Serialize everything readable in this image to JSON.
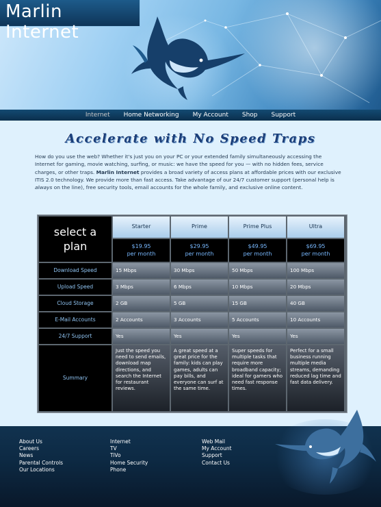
{
  "brand": {
    "name": "Marlin Internet"
  },
  "nav": {
    "items": [
      "Internet",
      "Home Networking",
      "My Account",
      "Shop",
      "Support"
    ],
    "active": "Internet"
  },
  "main": {
    "headline": "Accelerate with No Speed Traps",
    "intro": {
      "p1": "How do you use the web? Whether it's just you on your PC or your extended family simultaneously accessing the Internet for gaming, movie watching, surfing, or music: we have the speed for you — with no hidden fees, service charges, or other traps. ",
      "brand": "Marlin Internet",
      "p2": " provides a broad variety of access plans at affordable prices with our exclusive ITIS 2.0 technology. We provide more than fast access. Take advantage of our 24/7 customer support (personal help is ",
      "emph": "always",
      "p3": " on the line), free security tools, email accounts for the whole family, and exclusive online content."
    }
  },
  "plans": {
    "corner_line1": "select a",
    "corner_line2": "plan",
    "columns": [
      {
        "name": "Starter",
        "price": "$19.95",
        "period": "per month"
      },
      {
        "name": "Prime",
        "price": "$29.95",
        "period": "per month"
      },
      {
        "name": "Prime Plus",
        "price": "$49.95",
        "period": "per month"
      },
      {
        "name": "Ultra",
        "price": "$69.95",
        "period": "per month"
      }
    ],
    "rows": [
      {
        "label": "Download Speed",
        "values": [
          "15 Mbps",
          "30 Mbps",
          "50 Mbps",
          "100 Mbps"
        ]
      },
      {
        "label": "Upload Speed",
        "values": [
          "3 Mbps",
          "6 Mbps",
          "10 Mbps",
          "20 Mbps"
        ]
      },
      {
        "label": "Cloud Storage",
        "values": [
          "2 GB",
          "5 GB",
          "15 GB",
          "40 GB"
        ]
      },
      {
        "label": "E-Mail Accounts",
        "values": [
          "2 Accounts",
          "3 Accounts",
          "5 Accounts",
          "10 Accounts"
        ]
      },
      {
        "label": "24/7 Support",
        "values": [
          "Yes",
          "Yes",
          "Yes",
          "Yes"
        ]
      }
    ],
    "summary": {
      "label": "Summary",
      "values": [
        "Just the speed you need to send emails, download map directions, and search the Internet for restaurant reviews.",
        "A great speed at a great price for the family: kids can play games, adults can pay bills, and everyone can surf at the same time.",
        "Super speeds for multiple tasks that require more broadband capacity; ideal for gamers who need fast response times.",
        "Perfect for a small business running multiple media streams, demanding reduced lag time and fast data delivery."
      ]
    }
  },
  "footer": {
    "col1": [
      "About Us",
      "Careers",
      "News",
      "Parental Controls",
      "Our Locations"
    ],
    "col2": [
      "Internet",
      "TV",
      "TiVo",
      "Home Security",
      "Phone"
    ],
    "col3": [
      "Web Mail",
      "My Account",
      "Support",
      "Contact Us"
    ]
  },
  "icons": {
    "header_art": "marlin-fish-icon",
    "footer_art": "marlin-fish-icon"
  },
  "colors": {
    "price_text": "#79b9ff",
    "row_label_text": "#8fc3f1",
    "headline": "#1c3f79"
  }
}
